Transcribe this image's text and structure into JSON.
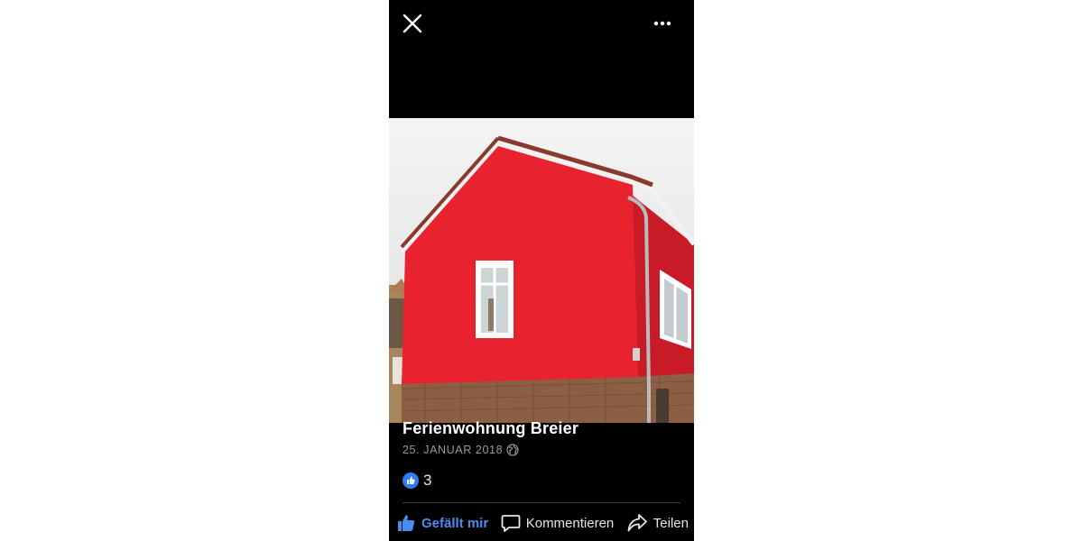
{
  "post": {
    "page_name": "Ferienwohnung Breier",
    "date": "25. JANUAR 2018",
    "reaction_count": "3"
  },
  "actions": {
    "like_label": "Gefällt mir",
    "comment_label": "Kommentieren",
    "share_label": "Teilen"
  },
  "icons": {
    "close": "close-icon",
    "more": "more-horizontal-icon",
    "privacy": "globe-icon",
    "reaction": "like-reaction-icon",
    "like": "thumbs-up-icon",
    "comment": "comment-bubble-icon",
    "share": "share-arrow-icon"
  },
  "colors": {
    "background": "#000000",
    "like_accent": "#4a8cf0",
    "house_wall": "#e8232f"
  }
}
